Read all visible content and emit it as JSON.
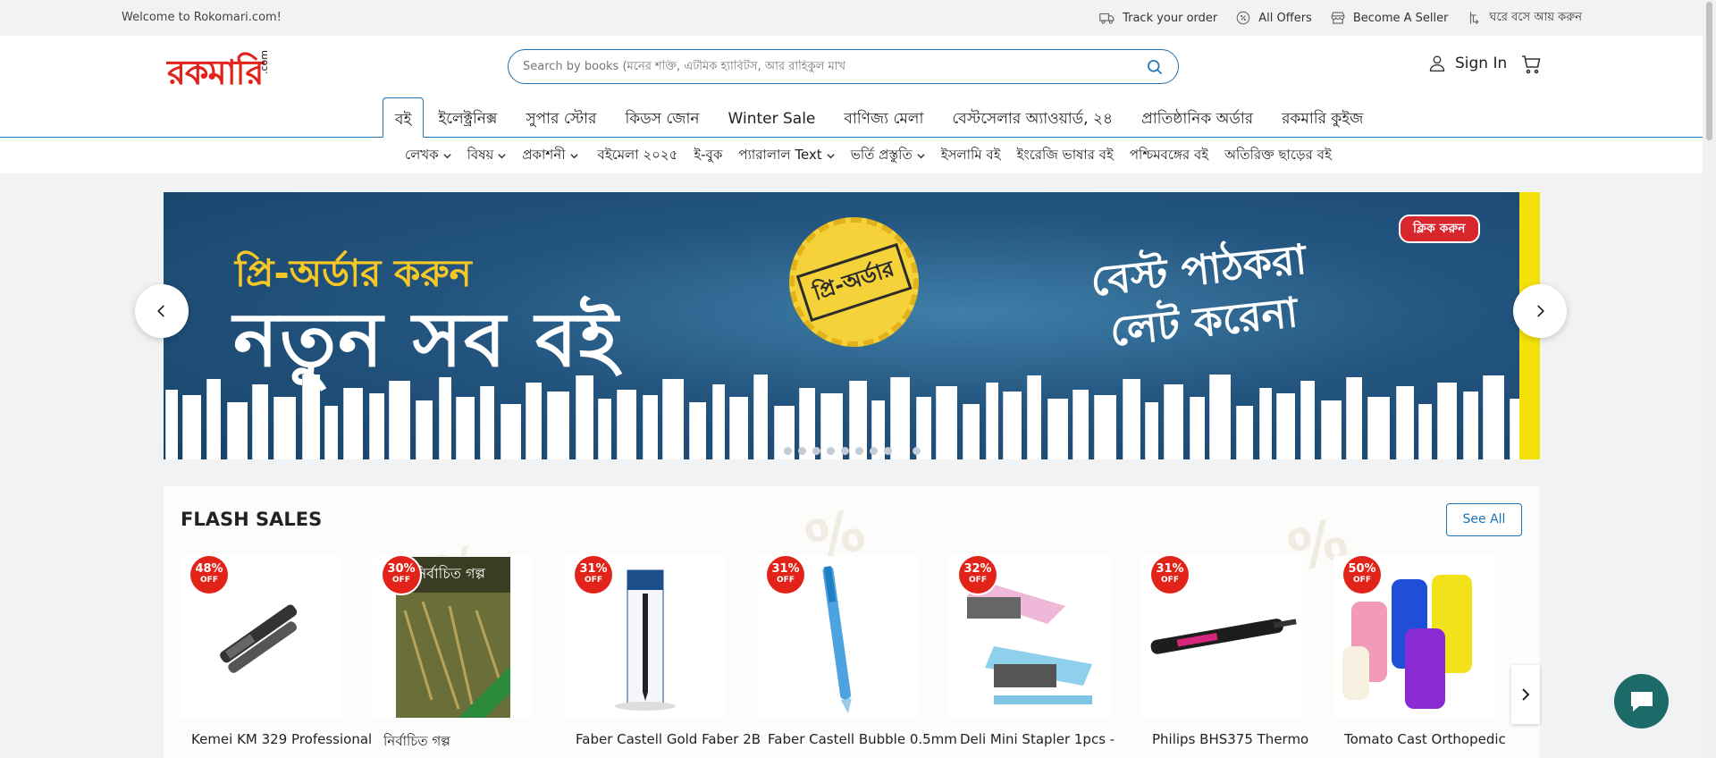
{
  "topbar": {
    "welcome": "Welcome to Rokomari.com!",
    "links": {
      "track": "Track your order",
      "offers": "All Offers",
      "seller": "Become A Seller",
      "home_earn": "ঘরে বসে আয় করুন"
    }
  },
  "header": {
    "logo_main": "রকমারি",
    "logo_suffix": ".com",
    "search_placeholder": "Search by books (মনের শক্তি, এটমিক হ্যাবিটস, আর রাহিকুল মাখ",
    "signin": "Sign In"
  },
  "main_nav": [
    "বই",
    "ইলেক্ট্রনিক্স",
    "সুপার স্টোর",
    "কিডস জোন",
    "Winter Sale",
    "বাণিজ্য মেলা",
    "বেস্টসেলার অ্যাওয়ার্ড, ২৪",
    "প্রাতিষ্ঠানিক অর্ডার",
    "রকমারি কুইজ"
  ],
  "sub_nav": [
    {
      "label": "লেখক",
      "dropdown": true
    },
    {
      "label": "বিষয়",
      "dropdown": true
    },
    {
      "label": "প্রকাশনী",
      "dropdown": true
    },
    {
      "label": "বইমেলা ২০২৫",
      "dropdown": false
    },
    {
      "label": "ই-বুক",
      "dropdown": false
    },
    {
      "label": "প্যারালাল Text",
      "dropdown": true
    },
    {
      "label": "ভর্তি প্রস্তুতি",
      "dropdown": true
    },
    {
      "label": "ইসলামি বই",
      "dropdown": false
    },
    {
      "label": "ইংরেজি ভাষার বই",
      "dropdown": false
    },
    {
      "label": "পশ্চিমবঙ্গের বই",
      "dropdown": false
    },
    {
      "label": "অতিরিক্ত ছাড়ের বই",
      "dropdown": false
    }
  ],
  "banner": {
    "preorder_line": "প্রি-অর্ডার করুন",
    "headline": "নতুন সব বই",
    "stamp": "প্রি-অর্ডার",
    "tagline_1": "বেস্ট পাঠকরা",
    "tagline_2": "লেট করেনা",
    "click": "ক্লিক করুন",
    "slide_count": 10,
    "active_slide": 8
  },
  "flash_sales": {
    "title": "FLASH SALES",
    "see_all": "See All",
    "products": [
      {
        "discount": "48%",
        "off": "OFF",
        "name": "Kemei KM 329 Professional",
        "img": "hair-straightener-black"
      },
      {
        "discount": "30%",
        "off": "OFF",
        "name": "নির্বাচিত গল্প",
        "img": "book-cover"
      },
      {
        "discount": "31%",
        "off": "OFF",
        "name": "Faber Castell Gold Faber 2B",
        "img": "pencil-pack"
      },
      {
        "discount": "31%",
        "off": "OFF",
        "name": "Faber Castell Bubble 0.5mm",
        "img": "mechanical-pencil"
      },
      {
        "discount": "32%",
        "off": "OFF",
        "name": "Deli Mini Stapler 1pcs -",
        "img": "staplers"
      },
      {
        "discount": "31%",
        "off": "OFF",
        "name": "Philips BHS375 Thermo",
        "img": "hair-straightener-pink"
      },
      {
        "discount": "50%",
        "off": "OFF",
        "name": "Tomato Cast Orthopedic",
        "img": "cast-rolls"
      }
    ]
  },
  "colors": {
    "brand_red": "#e2231a",
    "accent_blue": "#1a73b8",
    "chat_green": "#1c6b68"
  }
}
